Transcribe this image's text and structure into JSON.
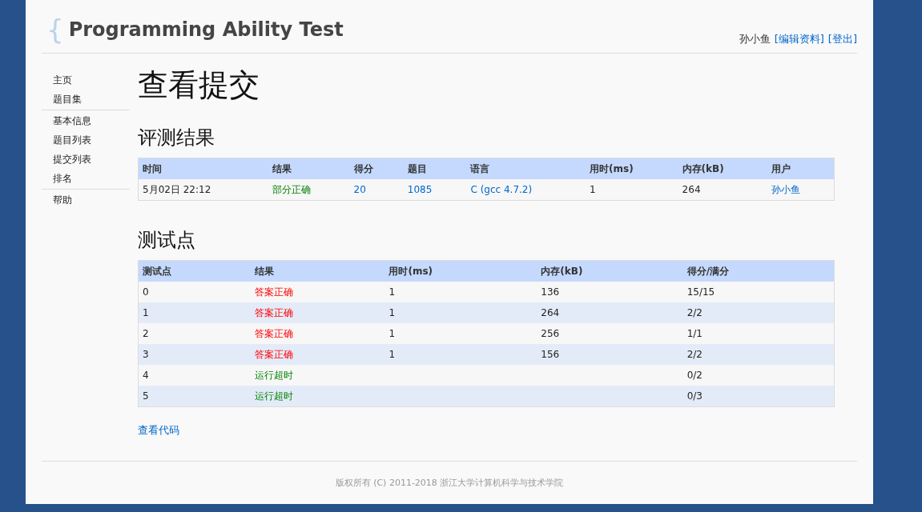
{
  "header": {
    "brace": "{",
    "title": "Programming Ability Test",
    "user": "孙小鱼",
    "links": [
      "[编辑资料]",
      "[登出]"
    ]
  },
  "sidebar": {
    "groups": [
      [
        "主页",
        "题目集"
      ],
      [
        "基本信息",
        "题目列表",
        "提交列表",
        "排名"
      ],
      [
        "帮助"
      ]
    ]
  },
  "page_title": "查看提交",
  "result": {
    "heading": "评测结果",
    "columns": [
      {
        "label": "时间",
        "link": false
      },
      {
        "label": "结果",
        "link": false
      },
      {
        "label": "得分",
        "link": true
      },
      {
        "label": "题目",
        "link": true
      },
      {
        "label": "语言",
        "link": true
      },
      {
        "label": "用时(ms)",
        "link": false
      },
      {
        "label": "内存(kB)",
        "link": false
      },
      {
        "label": "用户",
        "link": true
      }
    ],
    "row": {
      "time": "5月02日 22:12",
      "result": "部分正确",
      "kind": "partial",
      "score": "20",
      "problem": "1085",
      "language": "C (gcc 4.7.2)",
      "time_ms": "1",
      "memory": "264",
      "user": "孙小鱼"
    }
  },
  "tests": {
    "heading": "测试点",
    "columns": [
      "测试点",
      "结果",
      "用时(ms)",
      "内存(kB)",
      "得分/满分"
    ],
    "rows": [
      {
        "id": "0",
        "result": "答案正确",
        "kind": "accepted",
        "time_ms": "1",
        "memory": "136",
        "score": "15/15"
      },
      {
        "id": "1",
        "result": "答案正确",
        "kind": "accepted",
        "time_ms": "1",
        "memory": "264",
        "score": "2/2"
      },
      {
        "id": "2",
        "result": "答案正确",
        "kind": "accepted",
        "time_ms": "1",
        "memory": "256",
        "score": "1/1"
      },
      {
        "id": "3",
        "result": "答案正确",
        "kind": "accepted",
        "time_ms": "1",
        "memory": "156",
        "score": "2/2"
      },
      {
        "id": "4",
        "result": "运行超时",
        "kind": "timeout",
        "time_ms": "",
        "memory": "",
        "score": "0/2"
      },
      {
        "id": "5",
        "result": "运行超时",
        "kind": "timeout",
        "time_ms": "",
        "memory": "",
        "score": "0/3"
      }
    ]
  },
  "view_code": "查看代码",
  "footer": "版权所有 (C) 2011-2018 浙江大学计算机科学与技术学院"
}
